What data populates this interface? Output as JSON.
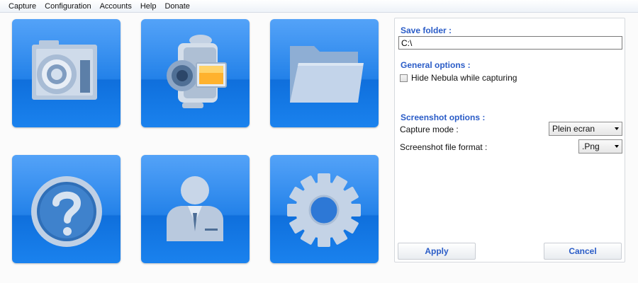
{
  "menu": [
    "Capture",
    "Configuration",
    "Accounts",
    "Help",
    "Donate"
  ],
  "tiles": [
    {
      "icon": "camera-icon"
    },
    {
      "icon": "video-camera-icon"
    },
    {
      "icon": "folder-icon"
    },
    {
      "icon": "help-icon"
    },
    {
      "icon": "user-account-icon"
    },
    {
      "icon": "settings-gear-icon"
    }
  ],
  "panel": {
    "save_folder_title": "Save folder :",
    "save_folder_value": "C:\\",
    "general_title": "General options :",
    "hide_label": "Hide Nebula while capturing",
    "hide_checked": false,
    "screenshot_title": "Screenshot options :",
    "capture_mode_label": "Capture mode :",
    "capture_mode_value": "Plein ecran",
    "file_format_label": "Screenshot file format :",
    "file_format_value": ".Png",
    "apply_label": "Apply",
    "cancel_label": "Cancel"
  },
  "colors": {
    "tile_blue": "#1b7de8",
    "accent_text": "#2a5cc7",
    "icon_fill": "#c9d6e6"
  }
}
